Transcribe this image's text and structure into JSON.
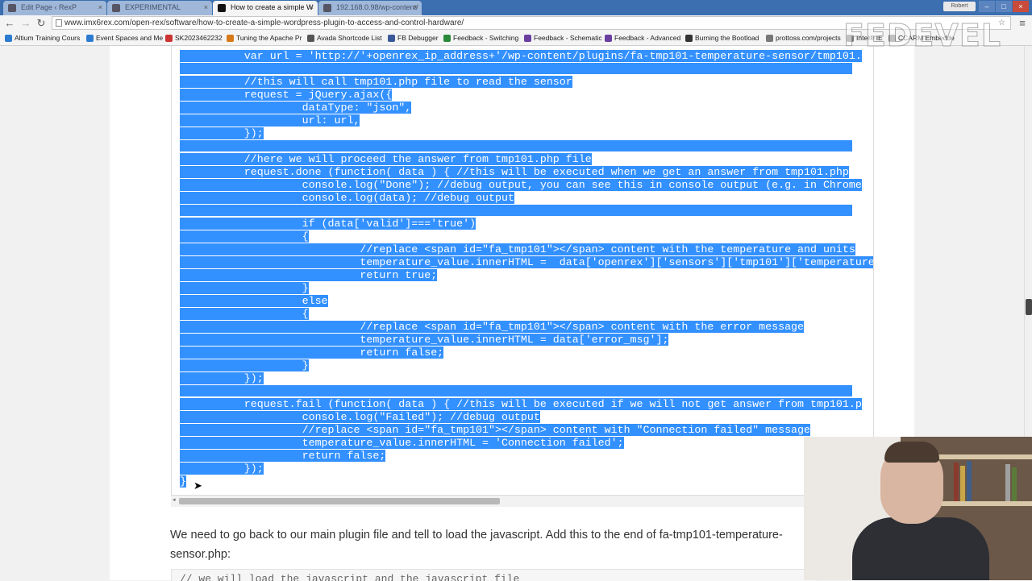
{
  "browser": {
    "tabs": [
      {
        "label": "Edit Page ‹ RexP"
      },
      {
        "label": "EXPERIMENTAL"
      },
      {
        "label": "How to create a simple W"
      },
      {
        "label": "192.168.0.98/wp-content/"
      }
    ],
    "user_badge": "Robert",
    "url": "www.imx6rex.com/open-rex/software/how-to-create-a-simple-wordpress-plugin-to-access-and-control-hardware/",
    "bookmarks": [
      {
        "label": "Altium Training Cours",
        "color": "#2c7bd1"
      },
      {
        "label": "Event Spaces and Me",
        "color": "#2c7bd1"
      },
      {
        "label": "SK2023462232",
        "color": "#c33"
      },
      {
        "label": "Tuning the Apache Pr",
        "color": "#d77a18"
      },
      {
        "label": "Avada Shortcode List",
        "color": "#555"
      },
      {
        "label": "FB Debugger",
        "color": "#3b5998"
      },
      {
        "label": "Feedback - Switching",
        "color": "#2a8a3a"
      },
      {
        "label": "Feedback - Schematic",
        "color": "#6a3fa0"
      },
      {
        "label": "Feedback - Advanced",
        "color": "#6a3fa0"
      },
      {
        "label": "Burning the Bootload",
        "color": "#333"
      },
      {
        "label": "prottoss.com/projects",
        "color": "#777"
      },
      {
        "label": "Intel® IE",
        "color": "#777"
      },
      {
        "label": "CCARM Embedde",
        "color": "#777"
      }
    ]
  },
  "code_lines": [
    "          var url = 'http://'+openrex_ip_address+'/wp-content/plugins/fa-tmp101-temperature-sensor/tmp101.",
    "",
    "          //this will call tmp101.php file to read the sensor",
    "          request = jQuery.ajax({",
    "                   dataType: \"json\",",
    "                   url: url,",
    "          });",
    "",
    "          //here we will proceed the answer from tmp101.php file",
    "          request.done (function( data ) { //this will be executed when we get an answer from tmp101.php",
    "                   console.log(\"Done\"); //debug output, you can see this in console output (e.g. in Chrome",
    "                   console.log(data); //debug output",
    "",
    "                   if (data['valid']==='true')",
    "                   {",
    "                            //replace <span id=\"fa_tmp101\"></span> content with the temperature and units",
    "                            temperature_value.innerHTML =  data['openrex']['sensors']['tmp101']['temperature",
    "                            return true;",
    "                   }",
    "                   else",
    "                   {",
    "                            //replace <span id=\"fa_tmp101\"></span> content with the error message",
    "                            temperature_value.innerHTML = data['error_msg'];",
    "                            return false;",
    "                   }",
    "          });",
    "",
    "          request.fail (function( data ) { //this will be executed if we will not get answer from tmp101.p",
    "                   console.log(\"Failed\"); //debug output",
    "                   //replace <span id=\"fa_tmp101\"></span> content with \"Connection failed\" message",
    "                   temperature_value.innerHTML = 'Connection failed';",
    "                   return false;",
    "          });",
    "}"
  ],
  "article": {
    "instruction_line1": "We need to go back to our main plugin file and tell to load the javascript. Add this to the end of fa-tmp101-temperature-",
    "instruction_line2": "sensor.php:",
    "next_code_partial": "// we will load the javascript and the javascript file"
  },
  "overlay": {
    "watermark": "FEDEVEL"
  }
}
